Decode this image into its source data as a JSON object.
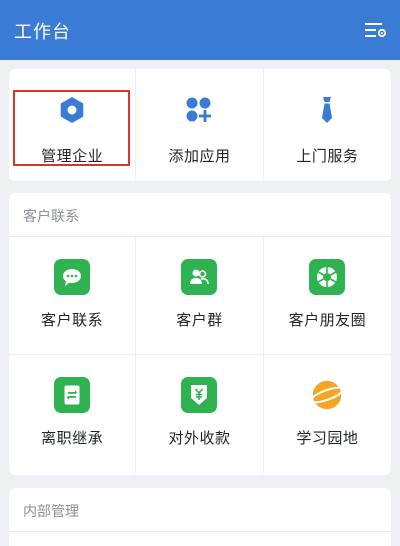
{
  "header": {
    "title": "工作台",
    "menu_icon": "filter-settings-icon"
  },
  "top_apps": [
    {
      "label": "管理企业",
      "icon": "hexagon-icon"
    },
    {
      "label": "添加应用",
      "icon": "add-apps-icon"
    },
    {
      "label": "上门服务",
      "icon": "necktie-icon"
    }
  ],
  "customer_section": {
    "title": "客户联系",
    "apps": [
      {
        "label": "客户联系",
        "icon": "chat-bubble-icon"
      },
      {
        "label": "客户群",
        "icon": "group-icon"
      },
      {
        "label": "客户朋友圈",
        "icon": "aperture-icon"
      },
      {
        "label": "离职继承",
        "icon": "transfer-icon"
      },
      {
        "label": "对外收款",
        "icon": "yen-shield-icon"
      },
      {
        "label": "学习园地",
        "icon": "planet-icon"
      }
    ]
  },
  "internal_section": {
    "title": "内部管理"
  },
  "colors": {
    "header": "#3a7bd5",
    "accent_blue": "#3a7bd5",
    "app_green": "#2fb350",
    "planet_orange": "#f5a524",
    "highlight_red": "#d9342b"
  }
}
